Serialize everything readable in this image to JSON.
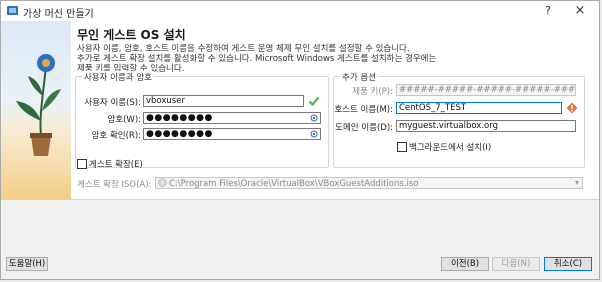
{
  "window": {
    "title": "가상 머신 만들기",
    "help": "?",
    "close": "×"
  },
  "page": {
    "title": "무인 게스트 OS 설치",
    "description_lines": [
      "사용자 이름, 암호, 호스트 이름을 수정하여 게스트 운영 체제 무인 설치를 설정할 수 있습니다.",
      "추가로 게스트 확장 설치를 활성화할 수 있습니다. Microsoft Windows 게스트를 설치하는 경우에는",
      "제품 키를 입력할 수 있습니다."
    ]
  },
  "user_group": {
    "title": "사용자 이름과 암호",
    "username_label": "사용자 이름(S):",
    "username_value": "vboxuser",
    "password_label": "암호(W):",
    "password_value": "●●●●●●●●",
    "confirm_label": "암호 확인(R):",
    "confirm_value": "●●●●●●●●"
  },
  "extra_group": {
    "title": "추가 옵션",
    "product_key_label": "제품 키(P):",
    "product_key_value": "#####-#####-#####-#####-#####",
    "hostname_label": "호스트 이름(M):",
    "hostname_value": "CentOS_7_TEST",
    "domain_label": "도메인 이름(D):",
    "domain_value": "myguest.virtualbox.org",
    "background_label": "백그라운드에서 설치(I)"
  },
  "guest_additions": {
    "checkbox_label": "게스트 확장(E)",
    "iso_label": "게스트 확장 ISO(A):",
    "iso_path": "C:\\Program Files\\Oracle\\VirtualBox\\VBoxGuestAdditions.iso"
  },
  "buttons": {
    "help": "도움말(H)",
    "back": "이전(B)",
    "next": "다음(N)",
    "cancel": "취소(C)"
  },
  "colors": {
    "accent": "#0078d7",
    "ok": "#5cb85c",
    "warning": "#e8743b"
  }
}
